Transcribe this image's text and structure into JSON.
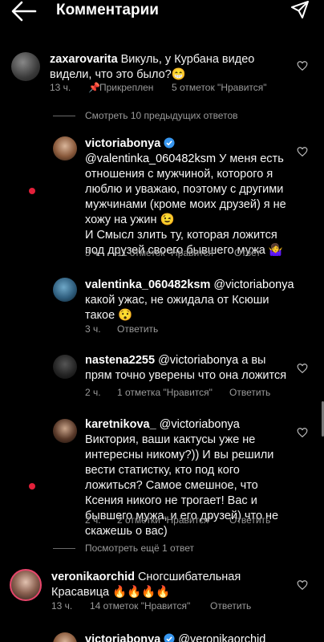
{
  "header": {
    "title": "Комментарии"
  },
  "comments": [
    {
      "username": "zaxarovarita",
      "text": "Викуль, у Курбана видео видели, что это было?😁",
      "time": "13 ч.",
      "pinned": "Прикреплен",
      "likes": "5 отметок \"Нравится\""
    }
  ],
  "view_previous": "Смотреть 10 предыдущих ответов",
  "replies": [
    {
      "username": "victoriabonya",
      "mention": "@valentinka_060482ksm",
      "text": "У меня есть отношения с мужчиной, которого я люблю и уважаю, поэтому с другими мужчинами (кроме моих друзей) я не хожу на ужин 😉\nИ Смысл злить ту, которая ложится под друзей своего бывшего мужа 🤷‍♀️",
      "time": "3 ч.",
      "likes": "11 отметок \"Нравится\"",
      "reply": "Ответ"
    },
    {
      "username": "valentinka_060482ksm",
      "mention": "@victoriabonya",
      "text": "какой ужас, не ожидала от Ксюши такое 😯",
      "time": "3 ч.",
      "reply": "Ответить"
    },
    {
      "username": "nastena2255",
      "mention": "@victoriabonya",
      "text": "а вы прям точно уверены что она ложится",
      "time": "2 ч.",
      "likes": "1 отметка \"Нравится\"",
      "reply": "Ответить"
    },
    {
      "username": "karetnikova_",
      "mention": "@victoriabonya",
      "text": "Виктория, ваши кактусы уже не интересны никому?)) И вы решили вести статистку, кто под кого ложиться? Самое смешное, что Ксения никого не трогает! Вас и бывшего мужа, и его друзей) что не скажешь о вас)",
      "time": "2 ч.",
      "likes": "2 отметки \"Нравится\"",
      "reply": "Ответить"
    }
  ],
  "view_more": "Посмотреть ещё 1 ответ",
  "comment2": {
    "username": "veronikaorchid",
    "text": "Сногсшибательная Красавица 🔥🔥🔥🔥",
    "time": "13 ч.",
    "likes": "14 отметок \"Нравится\"",
    "reply": "Ответить"
  },
  "partial": {
    "username": "victoriabonya",
    "mention": "@veronikaorchid"
  },
  "colors": {
    "background": "#000000",
    "secondary": "#9a9a9a",
    "verified": "#3897f0",
    "unread_dot": "#e3203a"
  }
}
